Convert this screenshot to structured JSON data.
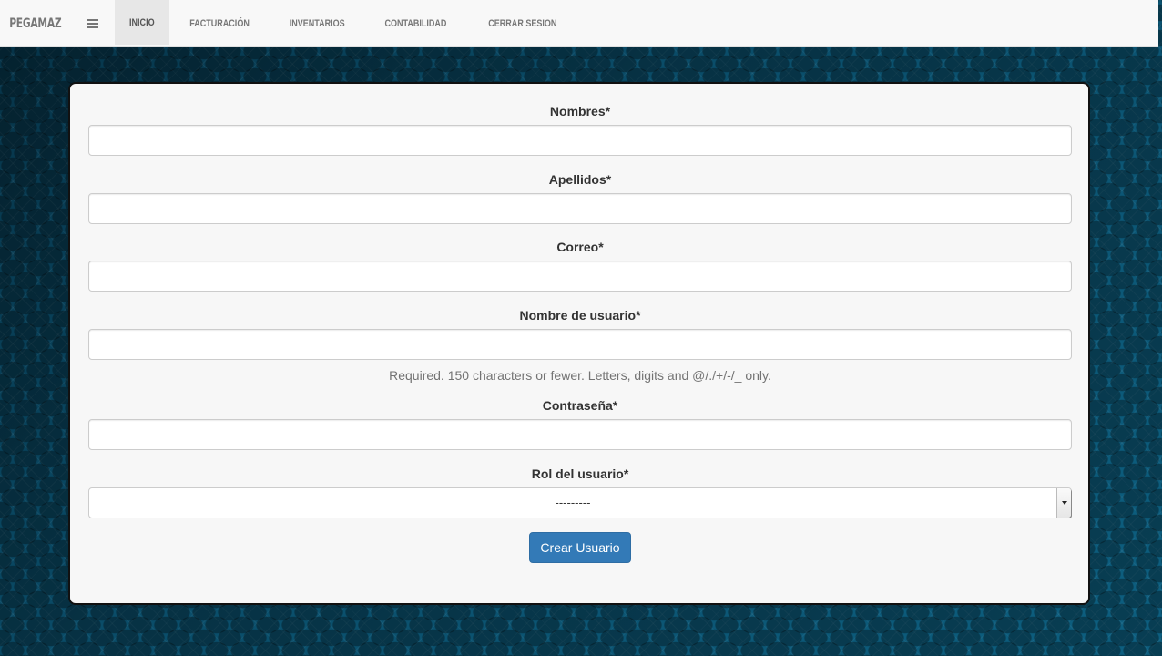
{
  "navbar": {
    "brand": "PEGAMAZ",
    "menu_icon": "hamburger-menu-icon",
    "items": [
      {
        "label": "INICIO",
        "active": true
      },
      {
        "label": "FACTURACIÓN",
        "active": false
      },
      {
        "label": "INVENTARIOS",
        "active": false
      },
      {
        "label": "CONTABILIDAD",
        "active": false
      },
      {
        "label": "CERRAR SESION",
        "active": false
      }
    ]
  },
  "form": {
    "fields": {
      "nombres": {
        "label": "Nombres*",
        "value": ""
      },
      "apellidos": {
        "label": "Apellidos*",
        "value": ""
      },
      "correo": {
        "label": "Correo*",
        "value": ""
      },
      "username": {
        "label": "Nombre de usuario*",
        "value": "",
        "help": "Required. 150 characters or fewer. Letters, digits and @/./+/-/_ only."
      },
      "password": {
        "label": "Contraseña*",
        "value": ""
      },
      "rol": {
        "label": "Rol del usuario*",
        "selected": "---------"
      }
    },
    "submit_label": "Crear Usuario"
  },
  "colors": {
    "primary": "#337ab7",
    "background": "#0a4660",
    "navbar": "#f8f8f8"
  }
}
